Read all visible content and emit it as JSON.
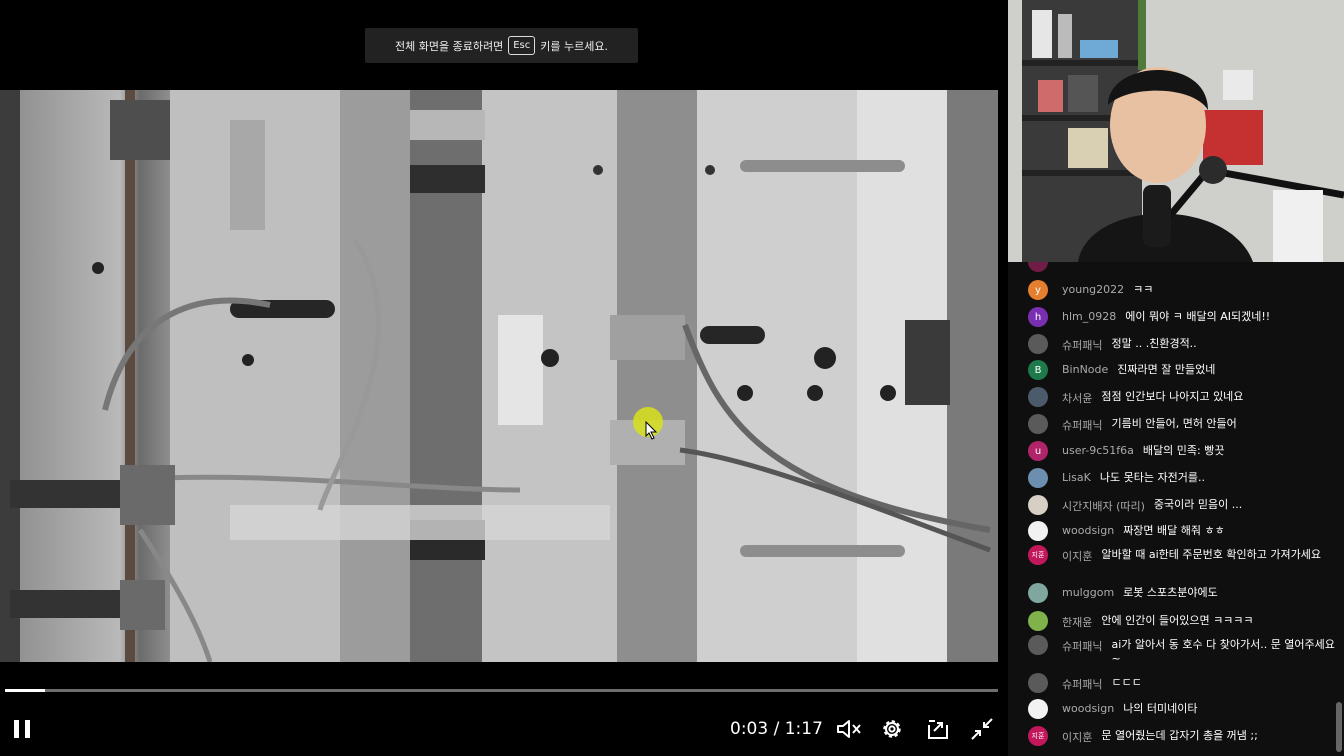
{
  "overlay": {
    "fullscreen_hint_before": "전체 화면을 종료하려면",
    "fullscreen_hint_key": "Esc",
    "fullscreen_hint_after": "키를 누르세요."
  },
  "player": {
    "current_time": "0:03",
    "duration": "1:17",
    "time_display": "0:03 / 1:17",
    "progress_fraction": 0.04,
    "controls": {
      "pause": "pause-icon",
      "mute": "muted-speaker-icon",
      "settings": "gear-icon",
      "pip": "picture-in-picture-icon",
      "exit_fullscreen": "exit-fullscreen-icon"
    }
  },
  "chat": {
    "messages": [
      {
        "author": "young2022",
        "text": "ㅋㅋ",
        "avatar_letter": "y",
        "avatar_color": "#e37f2f"
      },
      {
        "author": "hlm_0928",
        "text": "에이 뭐야 ㅋ 배달의 AI되겠네!!",
        "avatar_letter": "h",
        "avatar_color": "#7a2fb3"
      },
      {
        "author": "슈퍼패닉",
        "text": "정말 .. .친환경적..",
        "avatar_letter": "",
        "avatar_color": "#5a5a5a"
      },
      {
        "author": "BinNode",
        "text": "진짜라면 잘 만들었네",
        "avatar_letter": "B",
        "avatar_color": "#1e7a4a"
      },
      {
        "author": "차서윤",
        "text": "점점 인간보다 나아지고 있네요",
        "avatar_letter": "",
        "avatar_color": "#4b5b6b"
      },
      {
        "author": "슈퍼패닉",
        "text": "기름비 안들어, 면허 안들어",
        "avatar_letter": "",
        "avatar_color": "#5a5a5a"
      },
      {
        "author": "user-9c51f6a",
        "text": "배달의 민족: 빵끗",
        "avatar_letter": "u",
        "avatar_color": "#b0246a"
      },
      {
        "author": "LisaK",
        "text": "나도 못타는 자전거를..",
        "avatar_letter": "",
        "avatar_color": "#6c8fb0"
      },
      {
        "author": "시간지배자 (따리)",
        "text": "중국이라 믿음이 ...",
        "avatar_letter": "",
        "avatar_color": "#d8cfc4"
      },
      {
        "author": "woodsign",
        "text": "짜장면 배달 해줘 ㅎㅎ",
        "avatar_letter": "",
        "avatar_color": "#f2f2f2"
      },
      {
        "author": "이지훈",
        "text": "알바할 때 ai한테 주문번호 확인하고 가져가세요",
        "avatar_letter": "지훈",
        "avatar_color": "#c2185b"
      },
      {
        "author": "mulggom",
        "text": "로봇 스포츠분야에도",
        "avatar_letter": "",
        "avatar_color": "#7fa7a0"
      },
      {
        "author": "한재윤",
        "text": "안에 인간이 들어있으면 ㅋㅋㅋㅋ",
        "avatar_letter": "",
        "avatar_color": "#7fb24a"
      },
      {
        "author": "슈퍼패닉",
        "text": "ai가 알아서 동 호수 다 찾아가서.. 문 열어주세요~",
        "avatar_letter": "",
        "avatar_color": "#5a5a5a"
      },
      {
        "author": "슈퍼패닉",
        "text": "ㄷㄷㄷ",
        "avatar_letter": "",
        "avatar_color": "#5a5a5a"
      },
      {
        "author": "woodsign",
        "text": "나의 터미네이타",
        "avatar_letter": "",
        "avatar_color": "#f2f2f2"
      },
      {
        "author": "이지훈",
        "text": "문 열어줬는데 갑자기 총을 꺼냄 ;;",
        "avatar_letter": "지훈",
        "avatar_color": "#c2185b"
      }
    ]
  }
}
